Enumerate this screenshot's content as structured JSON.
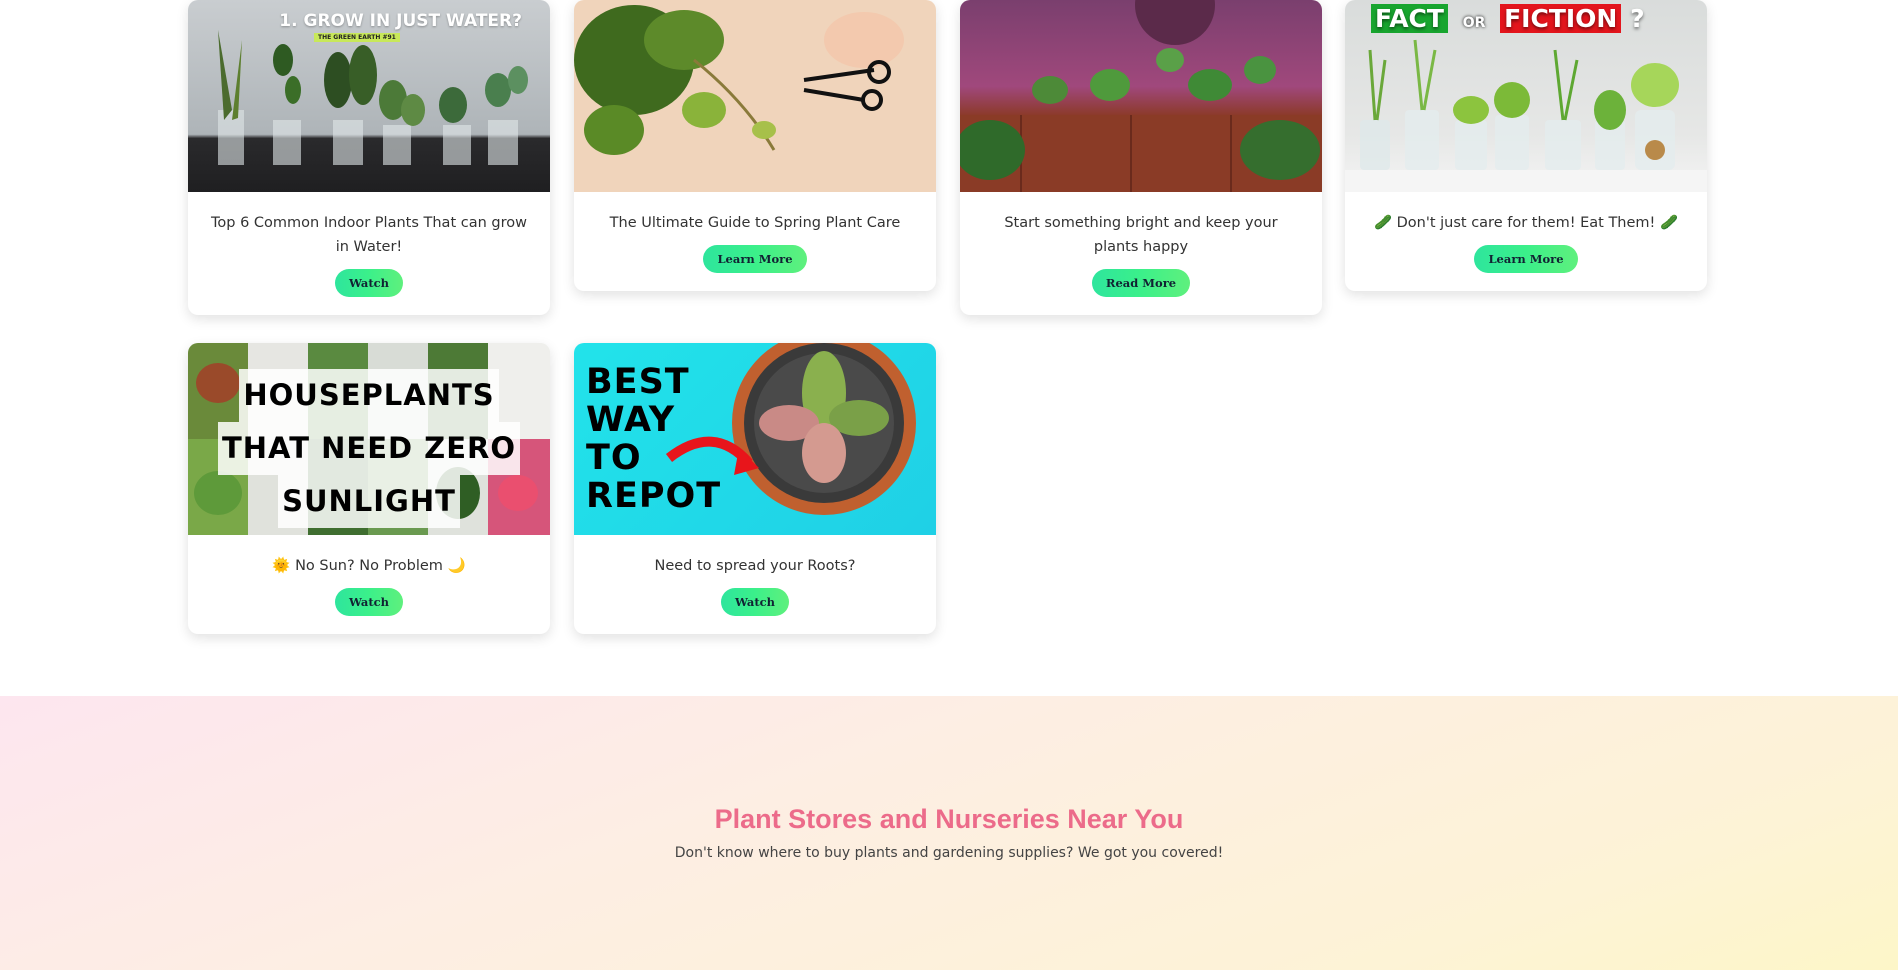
{
  "cards": [
    {
      "title": "Top 6 Common Indoor Plants That can grow in Water!",
      "button": "Watch",
      "thumb_text": "1. GROW IN JUST WATER?",
      "thumb_sub": "THE GREEN EARTH #91"
    },
    {
      "title": "The Ultimate Guide to Spring Plant Care",
      "button": "Learn More"
    },
    {
      "title": "Start something bright and keep your plants happy",
      "button": "Read More"
    },
    {
      "title": "🥒 Don't just care for them! Eat Them! 🥒",
      "button": "Learn More",
      "thumb_word1": "FACT",
      "thumb_or": "OR",
      "thumb_word2": "FICTION",
      "thumb_q": "?"
    },
    {
      "title": "🌞 No Sun? No Problem 🌙",
      "button": "Watch",
      "thumb_lines": [
        "HOUSEPLANTS",
        "THAT NEED ZERO",
        "SUNLIGHT"
      ]
    },
    {
      "title": "Need to spread your Roots?",
      "button": "Watch",
      "thumb_lines": [
        "BEST",
        "WAY",
        "TO",
        "REPOT"
      ]
    }
  ],
  "stores": {
    "heading": "Plant Stores and Nurseries Near You",
    "subtext": "Don't know where to buy plants and gardening supplies? We got you covered!"
  }
}
